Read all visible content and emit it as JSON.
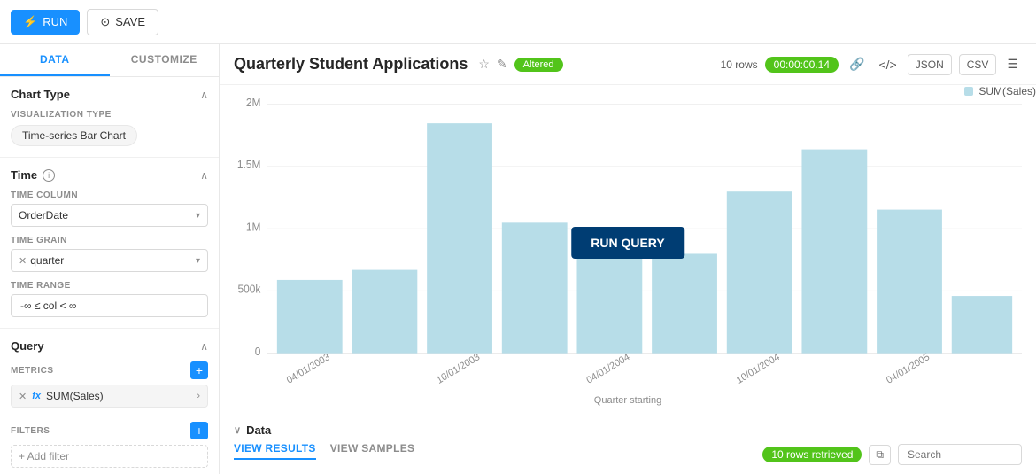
{
  "toolbar": {
    "run_label": "RUN",
    "save_label": "SAVE"
  },
  "sidebar": {
    "tab_data": "DATA",
    "tab_customize": "CUSTOMIZE",
    "chart_type": {
      "title": "Chart Type",
      "visualization_type_label": "VISUALIZATION TYPE",
      "visualization_type_value": "Time-series Bar Chart"
    },
    "time": {
      "title": "Time",
      "time_column_label": "TIME COLUMN",
      "time_column_value": "OrderDate",
      "time_grain_label": "TIME GRAIN",
      "time_grain_value": "quarter",
      "time_range_label": "TIME RANGE",
      "time_range_value": "-∞ ≤ col < ∞"
    },
    "query": {
      "title": "Query",
      "metrics_label": "METRICS",
      "metric_value": "SUM(Sales)",
      "filters_label": "FILTERS",
      "add_filter_placeholder": "+ Add filter"
    }
  },
  "content": {
    "chart_title": "Quarterly Student Applications",
    "altered_badge": "Altered",
    "rows_label": "10 rows",
    "time_badge": "00:00:00.14",
    "json_btn": "JSON",
    "csv_btn": "CSV",
    "legend_label": "SUM(Sales)",
    "x_axis_label": "Quarter starting",
    "run_query_btn": "RUN QUERY",
    "data_section_title": "Data",
    "view_results_tab": "VIEW RESULTS",
    "view_samples_tab": "VIEW SAMPLES",
    "rows_retrieved": "10 rows retrieved",
    "search_placeholder": "Search"
  },
  "chart": {
    "bars": [
      {
        "label": "04/01/2003",
        "height_pct": 28
      },
      {
        "label": "",
        "height_pct": 32
      },
      {
        "label": "10/01/2003",
        "height_pct": 88
      },
      {
        "label": "",
        "height_pct": 50
      },
      {
        "label": "04/01/2004",
        "height_pct": 45
      },
      {
        "label": "",
        "height_pct": 38
      },
      {
        "label": "10/01/2004",
        "height_pct": 62
      },
      {
        "label": "",
        "height_pct": 78
      },
      {
        "label": "04/01/2005",
        "height_pct": 55
      },
      {
        "label": "",
        "height_pct": 22
      }
    ],
    "y_labels": [
      "2M",
      "1.5M",
      "1M",
      "500k",
      "0"
    ],
    "bar_color": "#b7dde8"
  }
}
